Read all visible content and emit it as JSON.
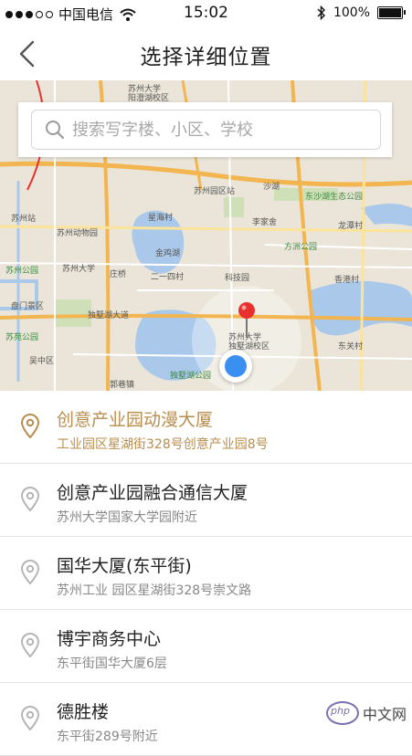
{
  "status_bar": {
    "carrier": "中国电信",
    "time": "15:02",
    "battery": "100%"
  },
  "nav": {
    "title": "选择详细位置",
    "back_icon": "chevron-left-icon"
  },
  "search": {
    "placeholder": "搜索写字楼、小区、学校",
    "value": ""
  },
  "map": {
    "labels": [
      {
        "text": "苏州大学",
        "cls": ""
      },
      {
        "text": "阳澄湖校区",
        "cls": ""
      },
      {
        "text": "苏州园区站",
        "cls": ""
      },
      {
        "text": "沙湖",
        "cls": ""
      },
      {
        "text": "东沙湖生态公园",
        "cls": "green"
      },
      {
        "text": "苏州站",
        "cls": ""
      },
      {
        "text": "苏州动物园",
        "cls": ""
      },
      {
        "text": "星海村",
        "cls": ""
      },
      {
        "text": "李家舍",
        "cls": ""
      },
      {
        "text": "方洲公园",
        "cls": "green"
      },
      {
        "text": "龙潭村",
        "cls": ""
      },
      {
        "text": "金鸡湖",
        "cls": ""
      },
      {
        "text": "苏州公园",
        "cls": "green"
      },
      {
        "text": "苏州大学",
        "cls": ""
      },
      {
        "text": "庄桥",
        "cls": ""
      },
      {
        "text": "二一四村",
        "cls": ""
      },
      {
        "text": "科技园",
        "cls": ""
      },
      {
        "text": "香港村",
        "cls": ""
      },
      {
        "text": "盘门景区",
        "cls": ""
      },
      {
        "text": "独墅湖大道",
        "cls": ""
      },
      {
        "text": "苏州大学",
        "cls": ""
      },
      {
        "text": "独墅湖校区",
        "cls": ""
      },
      {
        "text": "苏苑公园",
        "cls": "green"
      },
      {
        "text": "吴中区",
        "cls": ""
      },
      {
        "text": "东关村",
        "cls": ""
      },
      {
        "text": "独墅湖公园",
        "cls": "green"
      },
      {
        "text": "郭巷镇",
        "cls": ""
      }
    ]
  },
  "results": [
    {
      "name": "创意产业园动漫大厦",
      "address": "工业园区星湖街328号创意产业园8号",
      "active": true
    },
    {
      "name": "创意产业园融合通信大厦",
      "address": "苏州大学国家大学园附近",
      "active": false
    },
    {
      "name": "国华大厦(东平街)",
      "address": "苏州工业 园区星湖街328号崇文路",
      "active": false
    },
    {
      "name": "博宇商务中心",
      "address": "东平街国华大厦6层",
      "active": false
    },
    {
      "name": "德胜楼",
      "address": "东平街289号附近",
      "active": false
    }
  ],
  "watermark": {
    "logo_text": "php",
    "text": "中文网"
  },
  "colors": {
    "accent": "#b98d4e",
    "locate": "#3a8ff0",
    "pin": "#e8312f"
  }
}
